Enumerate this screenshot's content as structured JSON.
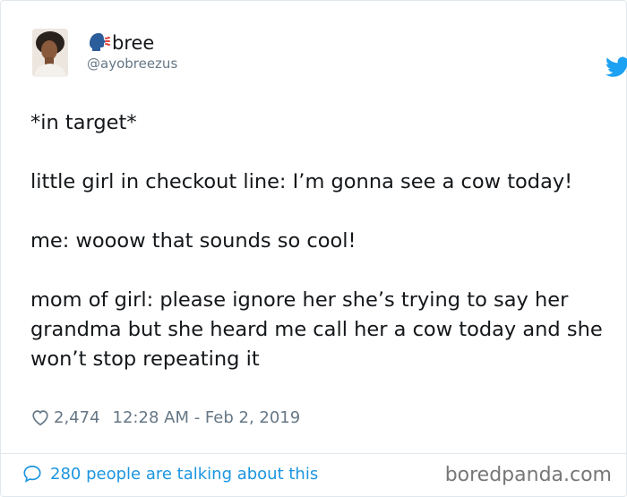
{
  "tweet": {
    "display_name": "bree",
    "handle": "@ayobreezus",
    "paragraphs": [
      "*in target*",
      "little girl in checkout line: I’m gonna see a cow today!",
      "me: wooow that sounds so cool!",
      "mom of girl: please ignore her she’s trying to say her grandma but she heard me call her a cow today and she won’t stop repeating it"
    ],
    "likes": "2,474",
    "timestamp": "12:28 AM - Feb 2, 2019",
    "talking": "280 people are talking about this"
  },
  "icons": {
    "name_emoji": "speaking-head-icon",
    "brand": "twitter-bird-icon",
    "like": "heart-icon",
    "reply": "speech-bubble-icon"
  },
  "colors": {
    "twitter_blue": "#1da1f2",
    "link_blue": "#1b95e0",
    "muted_gray": "#657786"
  },
  "watermark": "boredpanda.com"
}
